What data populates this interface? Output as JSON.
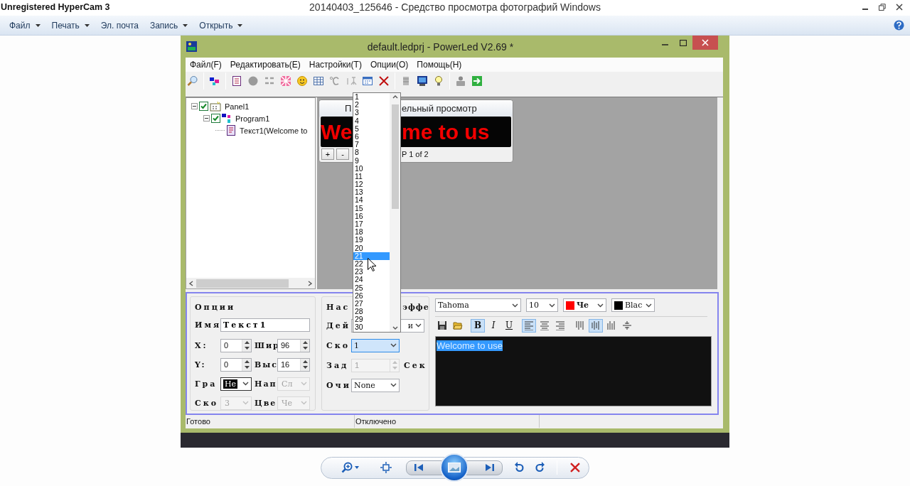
{
  "viewer": {
    "recorder_title": "Unregistered HyperCam 3",
    "title": "20140403_125646 - Средство просмотра фотографий Windows",
    "menu": [
      {
        "label": "Файл",
        "dropdown": true
      },
      {
        "label": "Печать",
        "dropdown": true
      },
      {
        "label": "Эл. почта",
        "dropdown": false
      },
      {
        "label": "Запись",
        "dropdown": true
      },
      {
        "label": "Открыть",
        "dropdown": true
      }
    ]
  },
  "app": {
    "title": "default.ledprj - PowerLed V2.69 *",
    "menu": [
      "Файл(F)",
      "Редактировать(E)",
      "Настройки(T)",
      "Опции(O)",
      "Помощь(H)"
    ],
    "tree": [
      {
        "label": "Panel1",
        "checked": true,
        "expanded": true,
        "children": [
          {
            "label": "Program1",
            "checked": true,
            "expanded": true,
            "children": [
              {
                "label": "Текст1(Welcome to"
              }
            ]
          }
        ]
      }
    ],
    "preview": {
      "title_left": "П",
      "title_right": "ельный просмотр",
      "led_left": "We",
      "led_right": "me to us",
      "buttons": [
        "+",
        "-"
      ],
      "page": "P 1 of 2"
    },
    "dropdown": {
      "items": [
        {
          "label": "1",
          "selected": false
        },
        {
          "label": "2",
          "selected": false
        },
        {
          "label": "3",
          "selected": false
        },
        {
          "label": "4",
          "selected": false
        },
        {
          "label": "5",
          "selected": false
        },
        {
          "label": "6",
          "selected": false
        },
        {
          "label": "7",
          "selected": false
        },
        {
          "label": "8",
          "selected": false
        },
        {
          "label": "9",
          "selected": false
        },
        {
          "label": "10",
          "selected": false
        },
        {
          "label": "11",
          "selected": false
        },
        {
          "label": "12",
          "selected": false
        },
        {
          "label": "13",
          "selected": false
        },
        {
          "label": "14",
          "selected": false
        },
        {
          "label": "15",
          "selected": false
        },
        {
          "label": "16",
          "selected": false
        },
        {
          "label": "17",
          "selected": false
        },
        {
          "label": "18",
          "selected": false
        },
        {
          "label": "19",
          "selected": false
        },
        {
          "label": "20",
          "selected": false
        },
        {
          "label": "21",
          "selected": true
        },
        {
          "label": "22",
          "selected": false
        },
        {
          "label": "23",
          "selected": false
        },
        {
          "label": "24",
          "selected": false
        },
        {
          "label": "25",
          "selected": false
        },
        {
          "label": "26",
          "selected": false
        },
        {
          "label": "27",
          "selected": false
        },
        {
          "label": "28",
          "selected": false
        },
        {
          "label": "29",
          "selected": false
        },
        {
          "label": "30",
          "selected": false
        }
      ]
    },
    "options": {
      "title": "Опции",
      "name": {
        "label": "Имя",
        "value": "Текст1"
      },
      "fields": [
        {
          "label": "X:",
          "value": "0",
          "kind": "spin",
          "disabled": false,
          "highlighted": false
        },
        {
          "label": "Шир",
          "value": "96",
          "kind": "spin",
          "disabled": false,
          "highlighted": false
        },
        {
          "label": "Y:",
          "value": "0",
          "kind": "spin",
          "disabled": false,
          "highlighted": false
        },
        {
          "label": "Выс",
          "value": "16",
          "kind": "spin",
          "disabled": false,
          "highlighted": false
        },
        {
          "label": "Гра",
          "value": "Не",
          "kind": "select",
          "disabled": false,
          "highlighted": true
        },
        {
          "label": "Нап",
          "value": "Сл",
          "kind": "select",
          "disabled": true,
          "highlighted": false
        },
        {
          "label": "Ско",
          "value": "3",
          "kind": "select",
          "disabled": true,
          "highlighted": false
        },
        {
          "label": "Цве",
          "value": "Че",
          "kind": "select",
          "disabled": true,
          "highlighted": false
        }
      ]
    },
    "effects": {
      "title_left": "Нас",
      "title_right": "эффе",
      "rows": [
        {
          "label": "Дей",
          "value": "и",
          "kind": "select",
          "disabled": false,
          "focused": false
        },
        {
          "label": "Ско",
          "value": "1",
          "kind": "select",
          "disabled": false,
          "focused": true
        },
        {
          "label": "Зад",
          "value": "1",
          "kind": "spin",
          "disabled": true,
          "focused": false,
          "suffix": "Сек"
        },
        {
          "label": "Очи",
          "value": "None",
          "kind": "select",
          "disabled": false,
          "focused": false
        }
      ]
    },
    "text_style": {
      "font": "Tahoma",
      "size": "10",
      "color": {
        "label": "Че",
        "color": "#ff0000"
      },
      "background": {
        "label": "Blac",
        "color": "#000000"
      },
      "format_buttons": [
        {
          "kind": "save",
          "selected": false
        },
        {
          "kind": "open",
          "selected": false
        },
        {
          "kind": "bold",
          "label": "B",
          "selected": true
        },
        {
          "kind": "italic",
          "label": "I",
          "selected": false
        },
        {
          "kind": "underline",
          "label": "U",
          "selected": false
        },
        {
          "kind": "align_left",
          "selected": true
        },
        {
          "kind": "align_center",
          "selected": false
        },
        {
          "kind": "align_right",
          "selected": false
        },
        {
          "kind": "valign_top",
          "selected": false
        },
        {
          "kind": "valign_middle",
          "selected": true
        },
        {
          "kind": "valign_bottom",
          "selected": false
        },
        {
          "kind": "split",
          "selected": false
        }
      ]
    },
    "editor": {
      "text": "Welcome to use",
      "selected": true
    },
    "status_bar": [
      "Готово",
      "Отключено"
    ]
  }
}
